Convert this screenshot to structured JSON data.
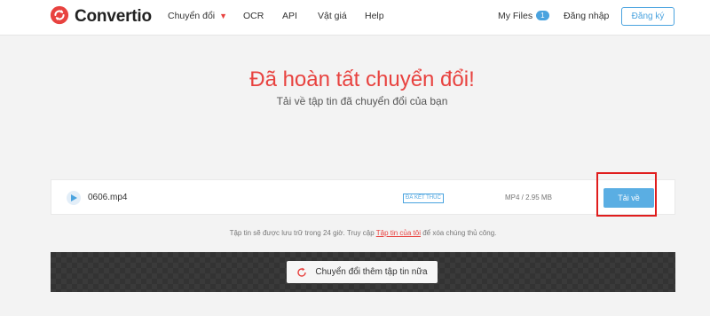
{
  "brand": {
    "name": "Convertio",
    "accent": "#e8423f",
    "link_color": "#4aa3df"
  },
  "nav": {
    "convert_label": "Chuyển đổi",
    "ocr_label": "OCR",
    "api_label": "API",
    "pricing_label": "Vật giá",
    "help_label": "Help",
    "my_files_label": "My Files",
    "my_files_count": "1",
    "login_label": "Đăng nhập",
    "signup_label": "Đăng ký"
  },
  "hero": {
    "title": "Đã hoàn tất chuyển đổi!",
    "subtitle": "Tải về tập tin đã chuyển đổi của bạn"
  },
  "file": {
    "icon": "play-icon",
    "name": "0606.mp4",
    "status": "ĐÃ KẾT THÚC",
    "meta": "MP4 / 2.95 MB",
    "download_label": "Tải về"
  },
  "info": {
    "text_before": "Tập tin sẽ được lưu trữ trong 24 giờ. Truy cập ",
    "link_label": "Tập tin của tôi",
    "text_after": " để xóa chúng thủ công."
  },
  "convert_more": {
    "icon": "refresh-icon",
    "label": "Chuyển đổi thêm tập tin nữa"
  }
}
